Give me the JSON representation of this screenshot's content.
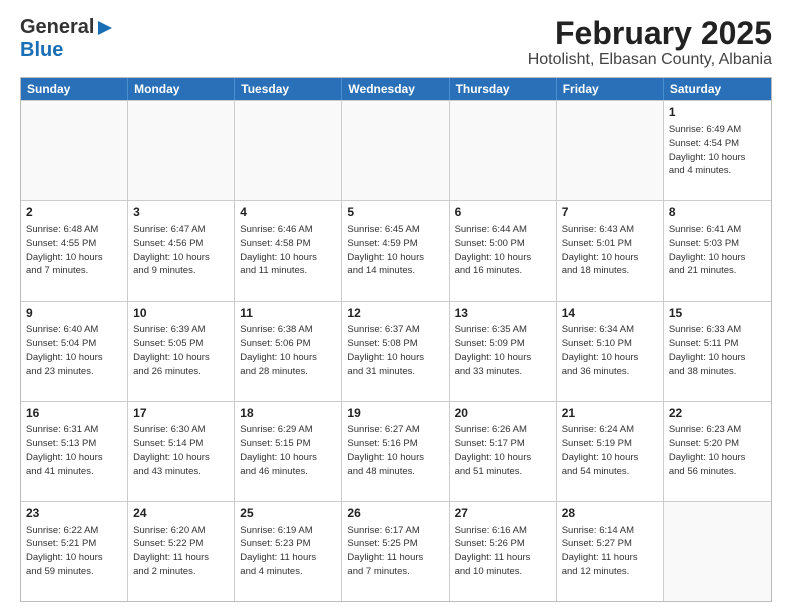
{
  "logo": {
    "general": "General",
    "blue": "Blue",
    "arrow": "▶"
  },
  "title": "February 2025",
  "subtitle": "Hotolisht, Elbasan County, Albania",
  "header": {
    "days": [
      "Sunday",
      "Monday",
      "Tuesday",
      "Wednesday",
      "Thursday",
      "Friday",
      "Saturday"
    ]
  },
  "weeks": [
    [
      {
        "day": "",
        "info": ""
      },
      {
        "day": "",
        "info": ""
      },
      {
        "day": "",
        "info": ""
      },
      {
        "day": "",
        "info": ""
      },
      {
        "day": "",
        "info": ""
      },
      {
        "day": "",
        "info": ""
      },
      {
        "day": "1",
        "info": "Sunrise: 6:49 AM\nSunset: 4:54 PM\nDaylight: 10 hours\nand 4 minutes."
      }
    ],
    [
      {
        "day": "2",
        "info": "Sunrise: 6:48 AM\nSunset: 4:55 PM\nDaylight: 10 hours\nand 7 minutes."
      },
      {
        "day": "3",
        "info": "Sunrise: 6:47 AM\nSunset: 4:56 PM\nDaylight: 10 hours\nand 9 minutes."
      },
      {
        "day": "4",
        "info": "Sunrise: 6:46 AM\nSunset: 4:58 PM\nDaylight: 10 hours\nand 11 minutes."
      },
      {
        "day": "5",
        "info": "Sunrise: 6:45 AM\nSunset: 4:59 PM\nDaylight: 10 hours\nand 14 minutes."
      },
      {
        "day": "6",
        "info": "Sunrise: 6:44 AM\nSunset: 5:00 PM\nDaylight: 10 hours\nand 16 minutes."
      },
      {
        "day": "7",
        "info": "Sunrise: 6:43 AM\nSunset: 5:01 PM\nDaylight: 10 hours\nand 18 minutes."
      },
      {
        "day": "8",
        "info": "Sunrise: 6:41 AM\nSunset: 5:03 PM\nDaylight: 10 hours\nand 21 minutes."
      }
    ],
    [
      {
        "day": "9",
        "info": "Sunrise: 6:40 AM\nSunset: 5:04 PM\nDaylight: 10 hours\nand 23 minutes."
      },
      {
        "day": "10",
        "info": "Sunrise: 6:39 AM\nSunset: 5:05 PM\nDaylight: 10 hours\nand 26 minutes."
      },
      {
        "day": "11",
        "info": "Sunrise: 6:38 AM\nSunset: 5:06 PM\nDaylight: 10 hours\nand 28 minutes."
      },
      {
        "day": "12",
        "info": "Sunrise: 6:37 AM\nSunset: 5:08 PM\nDaylight: 10 hours\nand 31 minutes."
      },
      {
        "day": "13",
        "info": "Sunrise: 6:35 AM\nSunset: 5:09 PM\nDaylight: 10 hours\nand 33 minutes."
      },
      {
        "day": "14",
        "info": "Sunrise: 6:34 AM\nSunset: 5:10 PM\nDaylight: 10 hours\nand 36 minutes."
      },
      {
        "day": "15",
        "info": "Sunrise: 6:33 AM\nSunset: 5:11 PM\nDaylight: 10 hours\nand 38 minutes."
      }
    ],
    [
      {
        "day": "16",
        "info": "Sunrise: 6:31 AM\nSunset: 5:13 PM\nDaylight: 10 hours\nand 41 minutes."
      },
      {
        "day": "17",
        "info": "Sunrise: 6:30 AM\nSunset: 5:14 PM\nDaylight: 10 hours\nand 43 minutes."
      },
      {
        "day": "18",
        "info": "Sunrise: 6:29 AM\nSunset: 5:15 PM\nDaylight: 10 hours\nand 46 minutes."
      },
      {
        "day": "19",
        "info": "Sunrise: 6:27 AM\nSunset: 5:16 PM\nDaylight: 10 hours\nand 48 minutes."
      },
      {
        "day": "20",
        "info": "Sunrise: 6:26 AM\nSunset: 5:17 PM\nDaylight: 10 hours\nand 51 minutes."
      },
      {
        "day": "21",
        "info": "Sunrise: 6:24 AM\nSunset: 5:19 PM\nDaylight: 10 hours\nand 54 minutes."
      },
      {
        "day": "22",
        "info": "Sunrise: 6:23 AM\nSunset: 5:20 PM\nDaylight: 10 hours\nand 56 minutes."
      }
    ],
    [
      {
        "day": "23",
        "info": "Sunrise: 6:22 AM\nSunset: 5:21 PM\nDaylight: 10 hours\nand 59 minutes."
      },
      {
        "day": "24",
        "info": "Sunrise: 6:20 AM\nSunset: 5:22 PM\nDaylight: 11 hours\nand 2 minutes."
      },
      {
        "day": "25",
        "info": "Sunrise: 6:19 AM\nSunset: 5:23 PM\nDaylight: 11 hours\nand 4 minutes."
      },
      {
        "day": "26",
        "info": "Sunrise: 6:17 AM\nSunset: 5:25 PM\nDaylight: 11 hours\nand 7 minutes."
      },
      {
        "day": "27",
        "info": "Sunrise: 6:16 AM\nSunset: 5:26 PM\nDaylight: 11 hours\nand 10 minutes."
      },
      {
        "day": "28",
        "info": "Sunrise: 6:14 AM\nSunset: 5:27 PM\nDaylight: 11 hours\nand 12 minutes."
      },
      {
        "day": "",
        "info": ""
      }
    ]
  ]
}
